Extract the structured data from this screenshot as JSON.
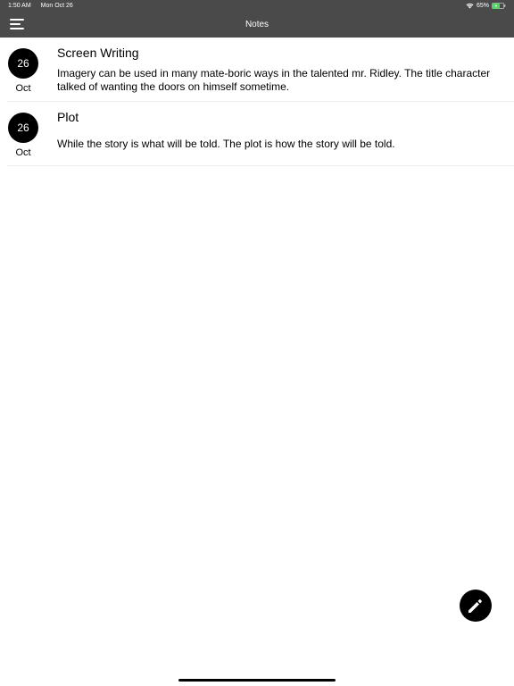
{
  "status_bar": {
    "time": "1:50 AM",
    "date": "Mon Oct 26",
    "battery": "65%"
  },
  "nav": {
    "title": "Notes",
    "menu_icon": "hamburger-menu-icon"
  },
  "notes": [
    {
      "day": "26",
      "month": "Oct",
      "title": "Screen Writing",
      "body": "Imagery can be used in many mate-boric ways in the talented mr. Ridley. The title character talked of wanting the doors on himself sometime."
    },
    {
      "day": "26",
      "month": "Oct",
      "title": "Plot",
      "body": "While the story is what will be told. The plot is how the story will be told."
    }
  ],
  "fab": {
    "icon": "pencil-icon"
  },
  "colors": {
    "bar": "#4a4a4a",
    "accent": "#000000",
    "battery_fill": "#4cd964"
  }
}
